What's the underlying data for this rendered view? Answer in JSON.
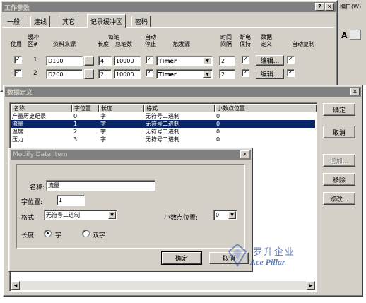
{
  "bg_window": {
    "title": "工作参数",
    "tabs": [
      "一般",
      "连线",
      "其它",
      "记录缓冲区",
      "密码"
    ],
    "active_tab": 3,
    "headers": {
      "use": "使用",
      "buf_l1": "缓冲",
      "buf_l2": "区#",
      "source": "资料来源",
      "per_l1": "每笔",
      "length": "长度",
      "total": "总笔数",
      "auto_l1": "自动",
      "auto_l2": "停止",
      "trigger": "触发源",
      "time_l1": "时间",
      "time_l2": "间隔",
      "power_l1": "断电",
      "power_l2": "保持",
      "data_l1": "数据",
      "data_l2": "定义",
      "autocopy": "自动复制"
    },
    "rows": [
      {
        "check": "✓",
        "num": "1",
        "source": "D100",
        "more": "..",
        "length": "4",
        "total": "10000",
        "auto": "✓",
        "trigger": "Timer",
        "interval": "2",
        "power": "✓",
        "edit": "编辑...",
        "copy": "✓"
      },
      {
        "check": "✓",
        "num": "2",
        "source": "D200",
        "more": "..",
        "length": "2",
        "total": "10000",
        "auto": "✓",
        "trigger": "Timer",
        "interval": "2",
        "power": "✓",
        "edit": "编辑...",
        "copy": "✓"
      }
    ],
    "right_frag": "编口(W)",
    "toolbar_frag": "A"
  },
  "data_def": {
    "title": "数据定义",
    "columns": [
      "名称",
      "字位置",
      "长度",
      "格式",
      "小数点位置"
    ],
    "items": [
      {
        "name": "产量历史纪录",
        "pos": "0",
        "len": "字",
        "fmt": "无符号二进制",
        "dec": "0"
      },
      {
        "name": "流量",
        "pos": "1",
        "len": "字",
        "fmt": "无符号二进制",
        "dec": "0"
      },
      {
        "name": "温度",
        "pos": "2",
        "len": "字",
        "fmt": "无符号二进制",
        "dec": "0"
      },
      {
        "name": "压力",
        "pos": "3",
        "len": "字",
        "fmt": "无符号二进制",
        "dec": "0"
      }
    ],
    "selected_index": 1,
    "buttons": {
      "ok": "确定",
      "cancel": "取消",
      "add": "增加...",
      "remove": "移除",
      "modify": "修改..."
    }
  },
  "modify": {
    "title": "Modify Data Item",
    "name_label": "名称:",
    "name_value": "流量",
    "pos_label": "字位置:",
    "pos_value": "1",
    "format_label": "格式:",
    "format_value": "无符号二进制",
    "dec_label": "小数点位置:",
    "dec_value": "0",
    "len_label": "长度:",
    "len_opt1": "字",
    "len_opt2": "双字",
    "ok": "确定",
    "cancel": "取消"
  },
  "watermark": {
    "cn": "罗升企业",
    "en": "Ace Pillar"
  },
  "colors": {
    "selection": "#0a246a",
    "face": "#d4d0c8",
    "watermark": "#2a4ea8"
  }
}
